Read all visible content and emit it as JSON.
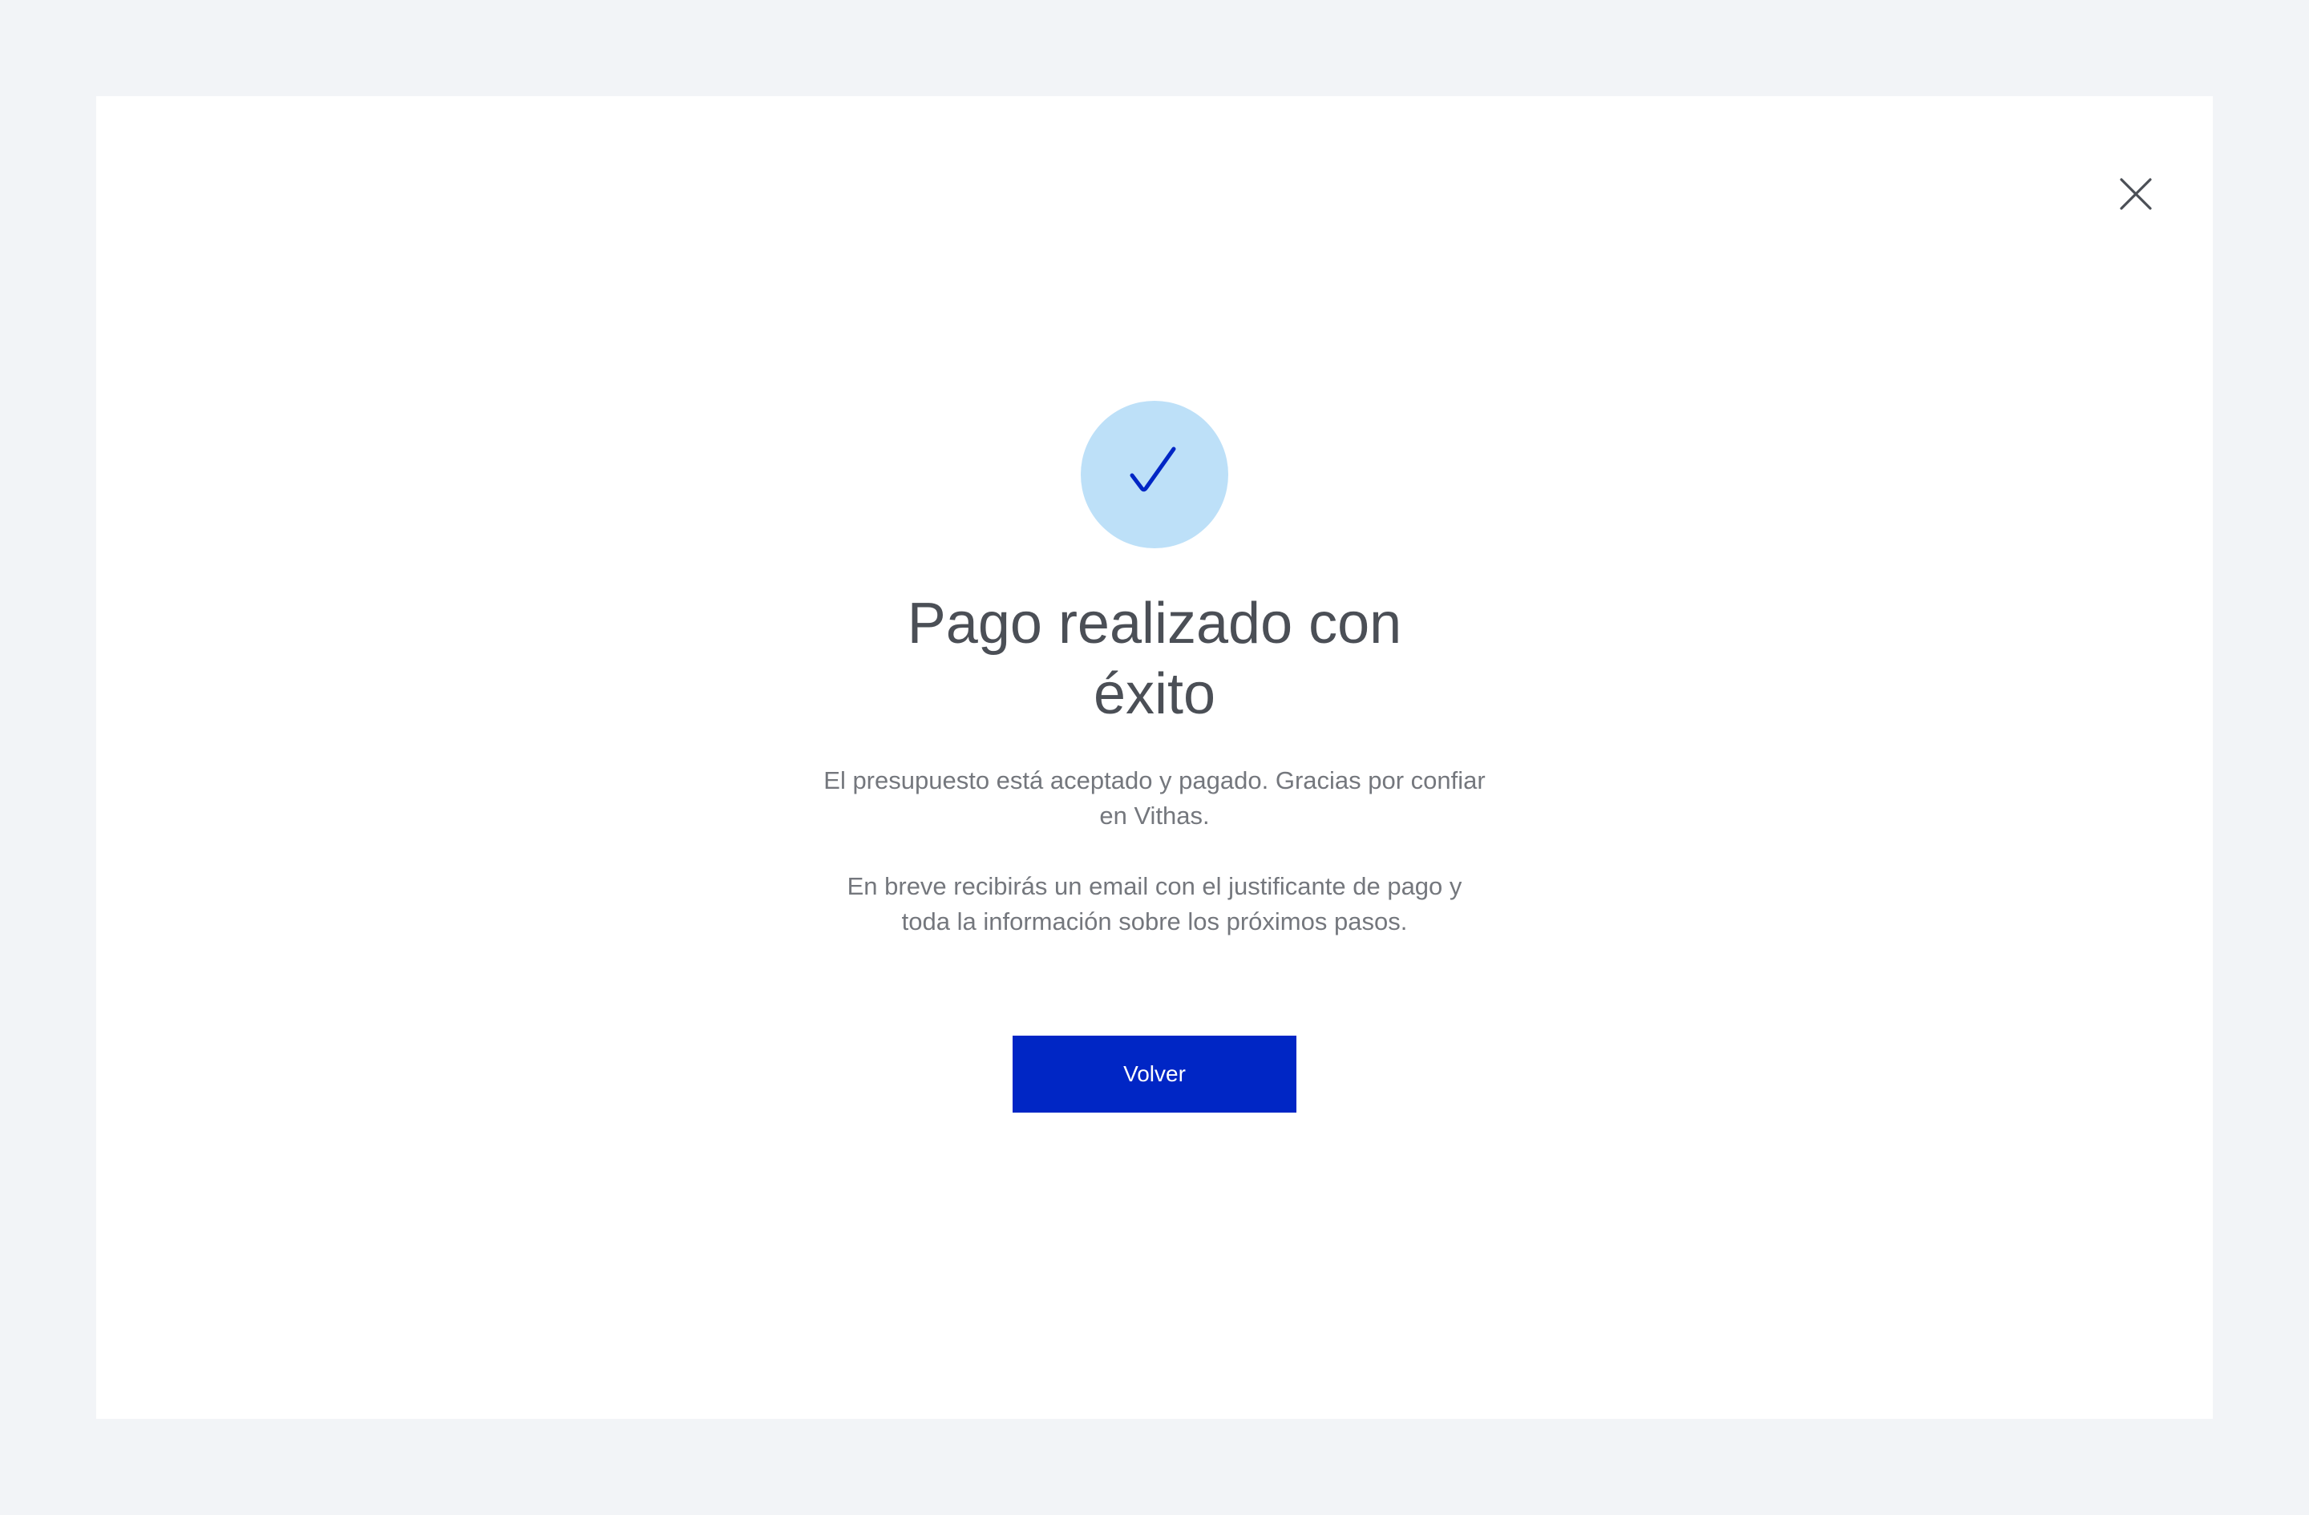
{
  "modal": {
    "close_icon": "close-icon",
    "status_icon": "checkmark-icon",
    "title": "Pago realizado con éxito",
    "message_1": "El presupuesto está aceptado y pagado. Gracias por confiar en Vithas.",
    "message_2": "En breve recibirás un email con el justificante de pago y toda la información sobre los próximos pasos.",
    "button_label": "Volver"
  },
  "colors": {
    "page_background": "#f2f4f7",
    "modal_background": "#ffffff",
    "success_circle": "#bde0f8",
    "checkmark": "#0026c5",
    "primary_button": "#0026c5",
    "title_text": "#4b4f56",
    "body_text": "#74777d",
    "close_icon": "#4b4f56"
  }
}
